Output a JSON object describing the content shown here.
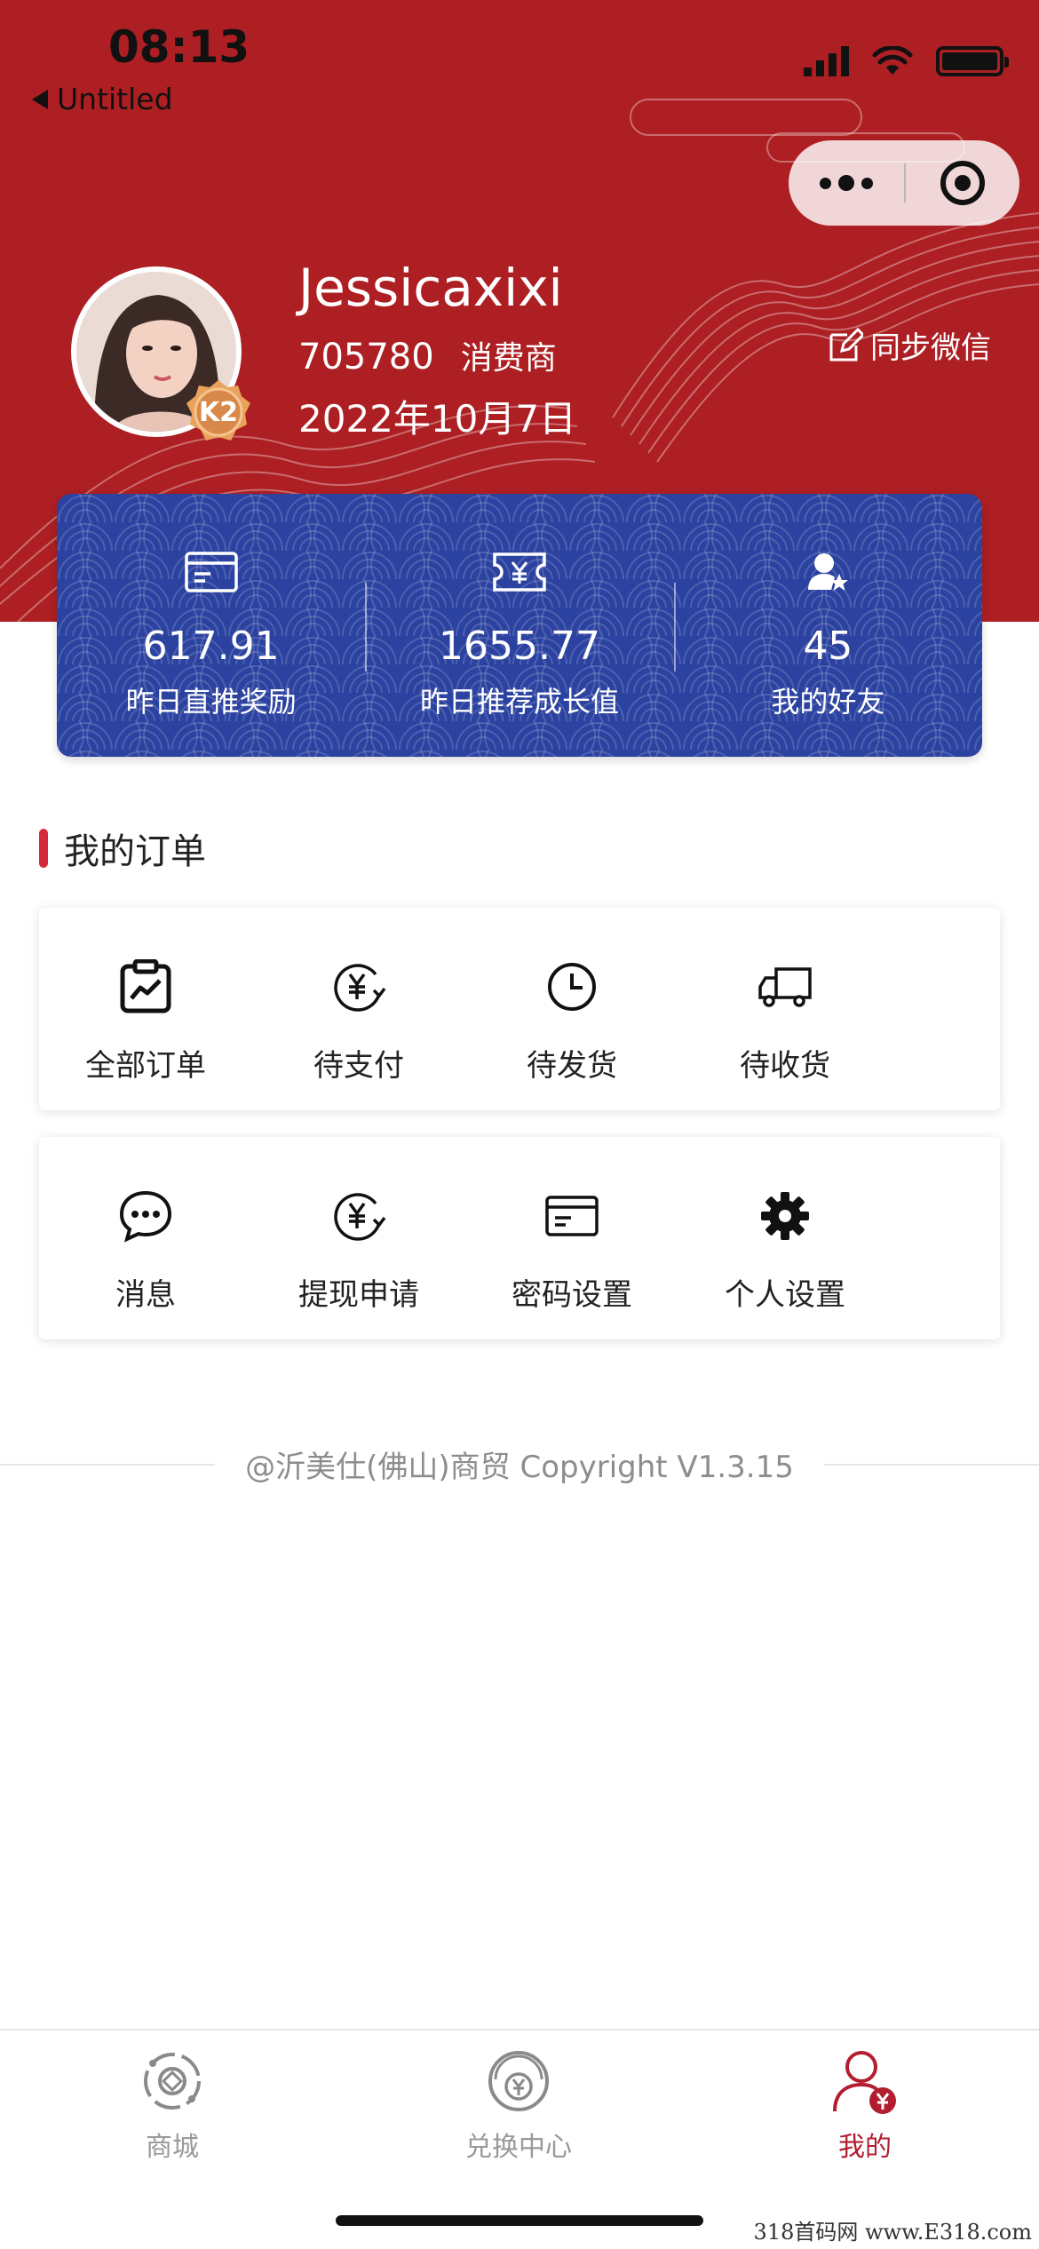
{
  "status_bar": {
    "time": "08:13",
    "back_label": "Untitled"
  },
  "profile": {
    "name": "Jessicaxixi",
    "id": "705780",
    "role": "消费商",
    "join_date": "2022年10月7日",
    "level": "K2",
    "sync_label": "同步微信"
  },
  "stats": [
    {
      "value": "617.91",
      "label": "昨日直推奖励",
      "icon": "card-icon"
    },
    {
      "value": "1655.77",
      "label": "昨日推荐成长值",
      "icon": "yen-ticket-icon"
    },
    {
      "value": "45",
      "label": "我的好友",
      "icon": "user-star-icon"
    }
  ],
  "orders": {
    "title": "我的订单",
    "row1": [
      {
        "label": "全部订单",
        "icon": "clipboard-chart-icon"
      },
      {
        "label": "待支付",
        "icon": "yen-refresh-icon"
      },
      {
        "label": "待发货",
        "icon": "clock-icon"
      },
      {
        "label": "待收货",
        "icon": "truck-icon"
      }
    ],
    "row2": [
      {
        "label": "消息",
        "icon": "chat-bubble-icon"
      },
      {
        "label": "提现申请",
        "icon": "yen-refresh-icon"
      },
      {
        "label": "密码设置",
        "icon": "card-icon"
      },
      {
        "label": "个人设置",
        "icon": "gear-icon"
      }
    ]
  },
  "copyright": "@沂美仕(佛山)商贸 Copyright V1.3.15",
  "tabbar": [
    {
      "label": "商城",
      "icon": "mall-icon",
      "active": false
    },
    {
      "label": "兑换中心",
      "icon": "exchange-yen-icon",
      "active": false
    },
    {
      "label": "我的",
      "icon": "profile-yen-icon",
      "active": true
    }
  ],
  "colors": {
    "header_red": "#ad1f22",
    "card_blue": "#2b42a0",
    "accent_red": "#b21e30"
  },
  "watermark": "318首码网  www.E318.com"
}
